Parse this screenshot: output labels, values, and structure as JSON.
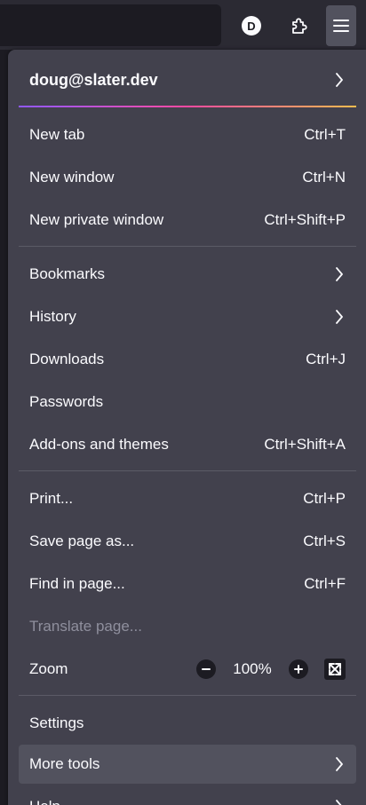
{
  "toolbar": {
    "account_initial": "D"
  },
  "menu": {
    "account": "doug@slater.dev",
    "new_tab": {
      "label": "New tab",
      "shortcut": "Ctrl+T"
    },
    "new_window": {
      "label": "New window",
      "shortcut": "Ctrl+N"
    },
    "new_private_window": {
      "label": "New private window",
      "shortcut": "Ctrl+Shift+P"
    },
    "bookmarks": {
      "label": "Bookmarks"
    },
    "history": {
      "label": "History"
    },
    "downloads": {
      "label": "Downloads",
      "shortcut": "Ctrl+J"
    },
    "passwords": {
      "label": "Passwords"
    },
    "addons": {
      "label": "Add-ons and themes",
      "shortcut": "Ctrl+Shift+A"
    },
    "print": {
      "label": "Print...",
      "shortcut": "Ctrl+P"
    },
    "save_page": {
      "label": "Save page as...",
      "shortcut": "Ctrl+S"
    },
    "find_in_page": {
      "label": "Find in page...",
      "shortcut": "Ctrl+F"
    },
    "translate_page": {
      "label": "Translate page..."
    },
    "zoom": {
      "label": "Zoom",
      "value": "100%"
    },
    "settings": {
      "label": "Settings"
    },
    "more_tools": {
      "label": "More tools"
    },
    "help": {
      "label": "Help"
    }
  },
  "colors": {
    "panel_bg": "#42414d",
    "toolbar_bg": "#2b2a33",
    "text": "#fbfbfe",
    "disabled_text": "#8f8f9d",
    "highlight": "#52525e"
  }
}
